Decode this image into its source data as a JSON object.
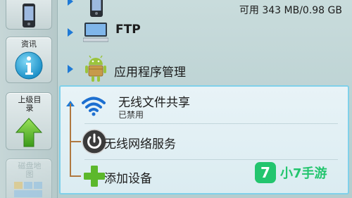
{
  "sidebar": {
    "items": [
      {
        "label": "资讯",
        "icon": "info-icon",
        "state": "active"
      },
      {
        "label": "上级目录",
        "icon": "up-arrow-icon",
        "state": "active"
      },
      {
        "label": "磁盘地图",
        "icon": "disk-map-icon",
        "state": "disabled"
      }
    ]
  },
  "list": {
    "storage_row": {
      "label": "可用 343 MB/0.98 GB",
      "icon": "phone-icon"
    },
    "ftp_row": {
      "label": "FTP",
      "icon": "monitor-icon"
    },
    "app_manager_row": {
      "label": "应用程序管理",
      "icon": "android-icon"
    }
  },
  "group": {
    "items": [
      {
        "title": "无线文件共享",
        "subtitle": "已禁用",
        "icon": "wifi-icon"
      },
      {
        "title": "无线网络服务",
        "icon": "power-icon"
      },
      {
        "title": "添加设备",
        "icon": "plus-icon"
      }
    ]
  },
  "watermark": {
    "text": "小7手游",
    "logo_char": "7"
  },
  "colors": {
    "accent": "#1f7ad6",
    "panel_border": "#7fd0ea",
    "tree_line": "#b07840",
    "watermark": "#23c56e",
    "plus": "#5cb82c"
  }
}
